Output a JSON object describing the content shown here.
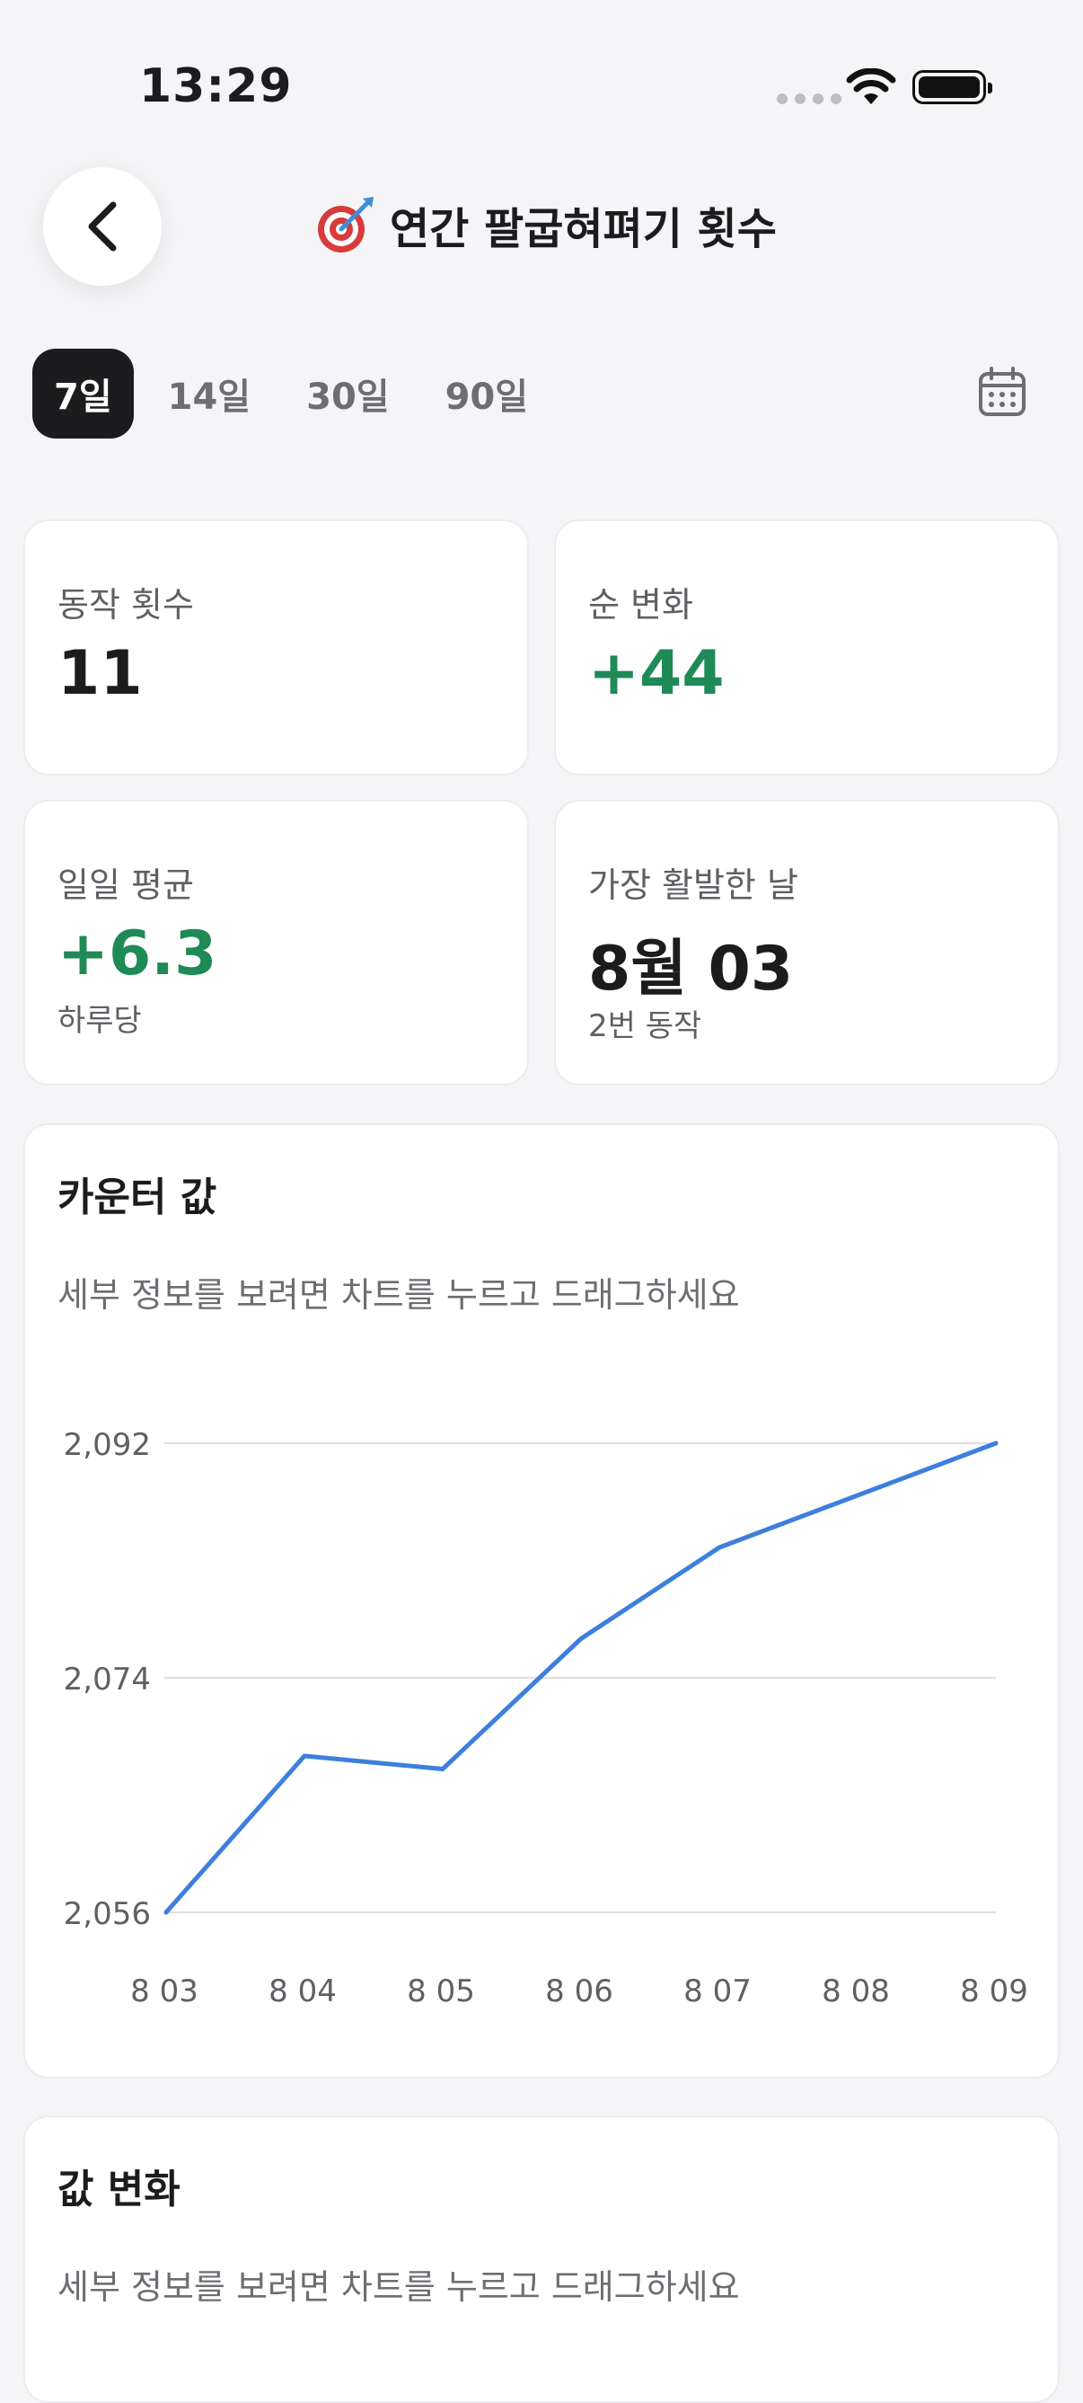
{
  "status_bar": {
    "time": "13:29"
  },
  "header": {
    "title": "연간 팔굽혀펴기 횟수",
    "title_icon": "target-dart-icon"
  },
  "range_tabs": [
    {
      "label": "7일",
      "active": true
    },
    {
      "label": "14일",
      "active": false
    },
    {
      "label": "30일",
      "active": false
    },
    {
      "label": "90일",
      "active": false
    }
  ],
  "stats": {
    "action_count": {
      "label": "동작 횟수",
      "value": "11"
    },
    "net_change": {
      "label": "순 변화",
      "value": "+44"
    },
    "daily_average": {
      "label": "일일 평균",
      "value": "+6.3",
      "sub": "하루당"
    },
    "most_active_day": {
      "label": "가장 활발한 날",
      "value": "8월 03",
      "sub": "2번 동작"
    }
  },
  "counter_chart": {
    "title": "카운터 값",
    "hint": "세부 정보를 보려면 차트를 누르고 드래그하세요"
  },
  "change_chart": {
    "title": "값 변화",
    "hint": "세부 정보를 보려면 차트를 누르고 드래그하세요"
  },
  "colors": {
    "accent": "#3d7fdd",
    "positive": "#1e8a55",
    "dark": "#1c1c1e"
  },
  "chart_data": {
    "type": "line",
    "categories": [
      "8월 03",
      "8월 04",
      "8월 05",
      "8월 06",
      "8월 07",
      "8월 08",
      "8월 09"
    ],
    "tick_labels": [
      "8 03",
      "8 04",
      "8 05",
      "8 06",
      "8 07",
      "8 08",
      "8 09"
    ],
    "series": [
      {
        "values": [
          2056,
          2068,
          2067,
          2077,
          2084,
          2088,
          2092
        ]
      }
    ],
    "yticks": [
      2056,
      2074,
      2092
    ],
    "ytick_labels": [
      "2,056",
      "2,074",
      "2,092"
    ],
    "ylim": [
      2056,
      2092
    ],
    "grid": true
  }
}
